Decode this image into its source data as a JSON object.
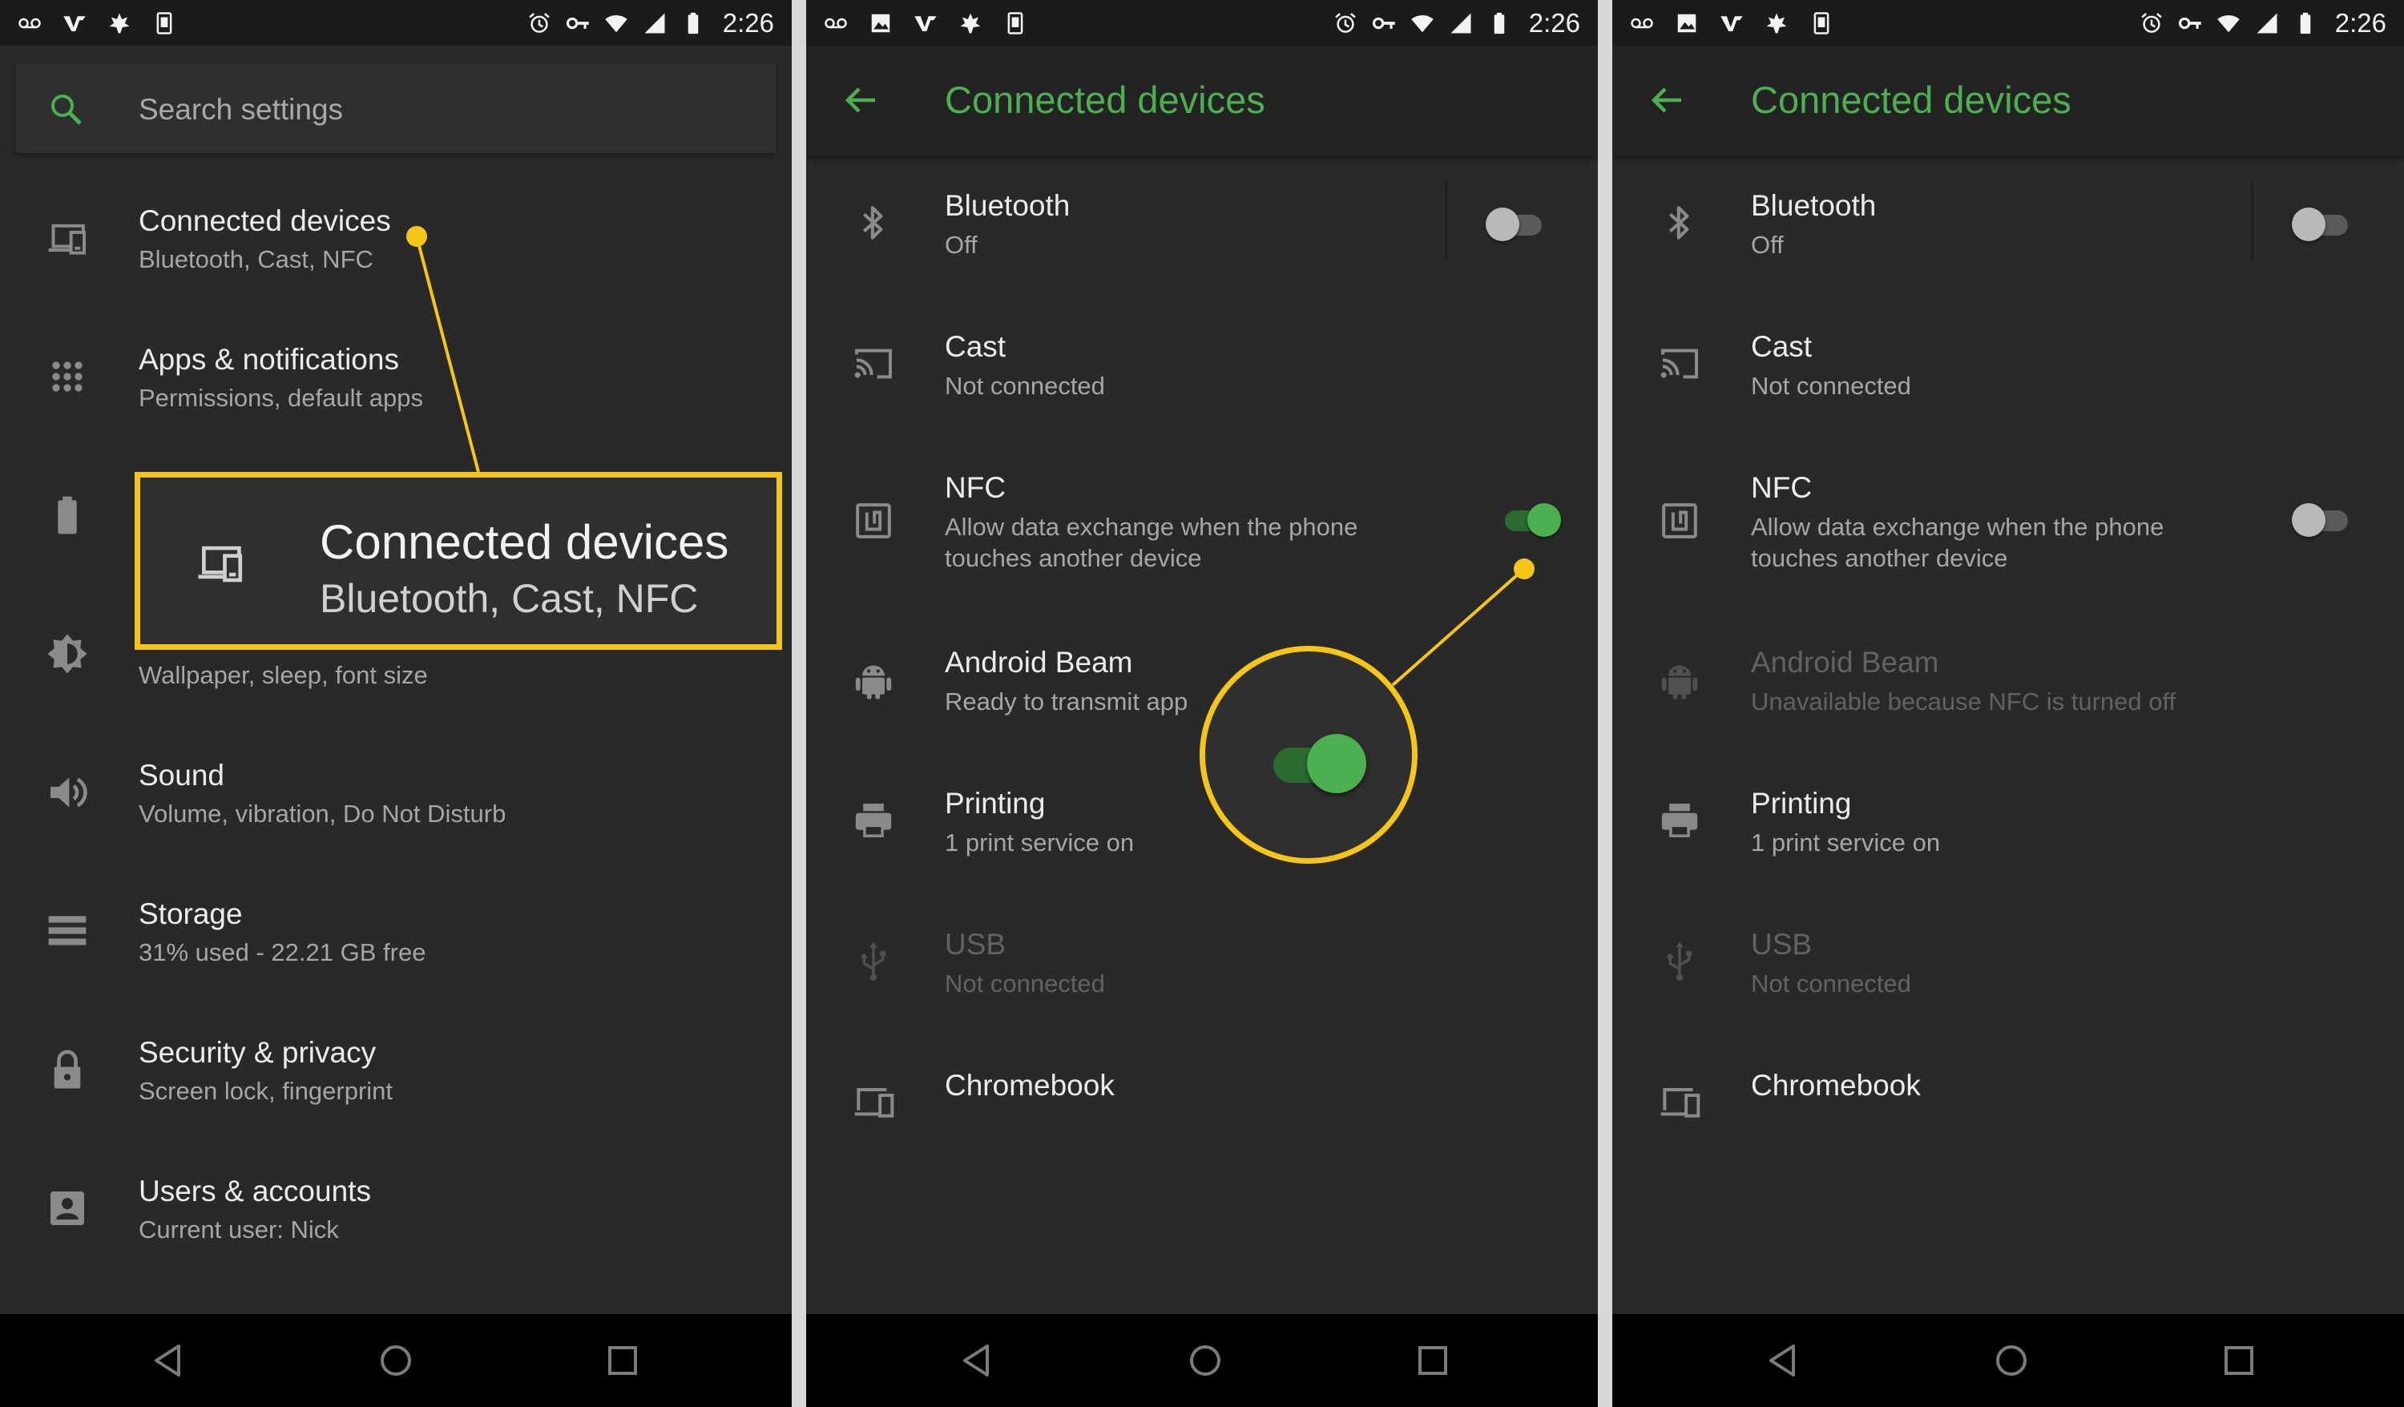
{
  "status_bar": {
    "time": "2:26"
  },
  "panel1": {
    "search_placeholder": "Search settings",
    "items": [
      {
        "title": "Connected devices",
        "subtitle": "Bluetooth, Cast, NFC",
        "icon": "devices-icon"
      },
      {
        "title": "Apps & notifications",
        "subtitle": "Permissions, default apps",
        "icon": "apps-icon"
      },
      {
        "title": "",
        "subtitle": "",
        "icon": "battery-icon"
      },
      {
        "title": "",
        "subtitle": "Wallpaper, sleep, font size",
        "icon": "brightness-icon"
      },
      {
        "title": "Sound",
        "subtitle": "Volume, vibration, Do Not Disturb",
        "icon": "volume-icon"
      },
      {
        "title": "Storage",
        "subtitle": "31% used - 22.21 GB free",
        "icon": "storage-icon"
      },
      {
        "title": "Security & privacy",
        "subtitle": "Screen lock, fingerprint",
        "icon": "lock-icon"
      },
      {
        "title": "Users & accounts",
        "subtitle": "Current user: Nick",
        "icon": "account-icon"
      }
    ],
    "callout": {
      "title": "Connected devices",
      "subtitle": "Bluetooth, Cast, NFC"
    }
  },
  "panel2": {
    "title": "Connected devices",
    "items": [
      {
        "title": "Bluetooth",
        "subtitle": "Off",
        "toggle": "off"
      },
      {
        "title": "Cast",
        "subtitle": "Not connected"
      },
      {
        "title": "NFC",
        "subtitle_line1": "Allow data exchange when the phone",
        "subtitle_line2": "touches another device",
        "toggle": "on"
      },
      {
        "title": "Android Beam",
        "subtitle": "Ready to transmit app"
      },
      {
        "title": "Printing",
        "subtitle": "1 print service on"
      },
      {
        "title": "USB",
        "subtitle": "Not connected",
        "disabled": true
      },
      {
        "title": "Chromebook"
      }
    ]
  },
  "panel3": {
    "title": "Connected devices",
    "items": [
      {
        "title": "Bluetooth",
        "subtitle": "Off",
        "toggle": "off"
      },
      {
        "title": "Cast",
        "subtitle": "Not connected"
      },
      {
        "title": "NFC",
        "subtitle_line1": "Allow data exchange when the phone",
        "subtitle_line2": "touches another device",
        "toggle": "off"
      },
      {
        "title": "Android Beam",
        "subtitle": "Unavailable because NFC is turned off",
        "disabled": true
      },
      {
        "title": "Printing",
        "subtitle": "1 print service on"
      },
      {
        "title": "USB",
        "subtitle": "Not connected",
        "disabled": true
      },
      {
        "title": "Chromebook"
      }
    ]
  },
  "colors": {
    "accent": "#4caf50",
    "callout": "#f5c518",
    "background": "#292929"
  }
}
